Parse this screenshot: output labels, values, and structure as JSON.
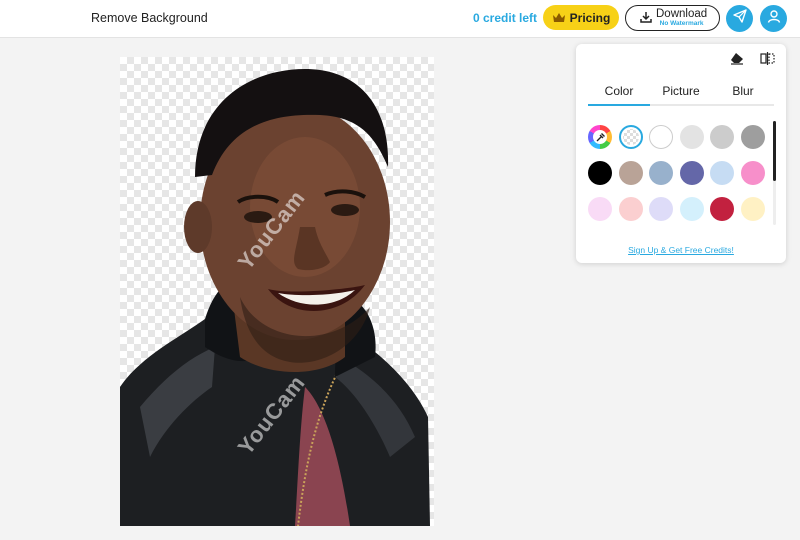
{
  "header": {
    "title": "Remove Background",
    "credits": "0 credit left",
    "pricing_label": "Pricing",
    "download_label": "Download",
    "download_sub": "No Watermark",
    "accent": "#29a9e0",
    "pricing_color": "#f7d117"
  },
  "canvas": {
    "watermark": "YouCam"
  },
  "panel": {
    "tools": [
      "eraser-icon",
      "compare-icon"
    ],
    "tabs": [
      {
        "label": "Color",
        "active": true
      },
      {
        "label": "Picture",
        "active": false
      },
      {
        "label": "Blur",
        "active": false
      }
    ],
    "swatches": [
      "picker",
      "transparent",
      "#ffffff",
      "#e3e3e3",
      "#cccccc",
      "#9e9e9e",
      "#000000",
      "#b9a397",
      "#98b1cc",
      "#6467a8",
      "#c6dcf3",
      "#f78fca",
      "#f9dbf6",
      "#fbcfd0",
      "#dedcf8",
      "#d4f0fc",
      "#c2213f",
      "#fff1c4"
    ],
    "signup": "Sign Up & Get Free Credits!"
  }
}
